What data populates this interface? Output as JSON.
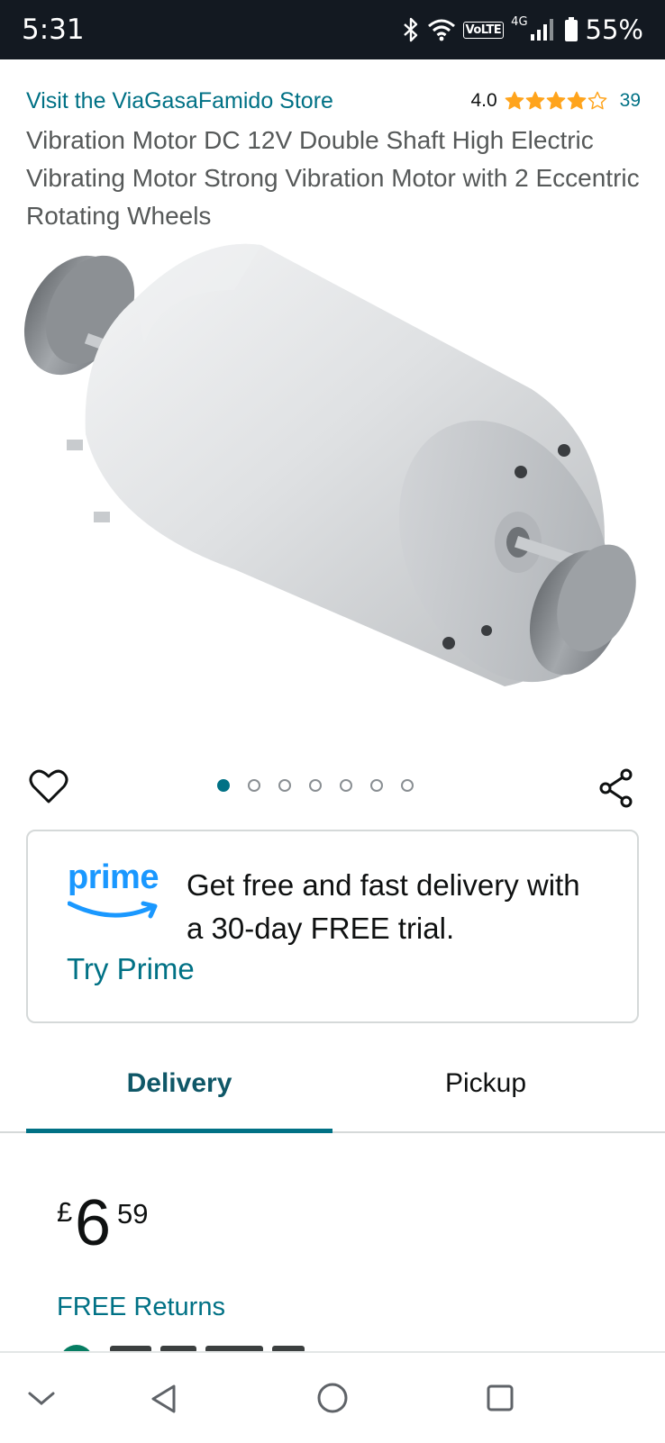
{
  "status_bar": {
    "time": "5:31",
    "volte": "VoLTE",
    "network": "4G",
    "battery": "55%"
  },
  "store": {
    "link_text": "Visit the ViaGasaFamido Store",
    "rating": "4.0",
    "stars_filled": 4,
    "stars_total": 5,
    "rating_count": "39"
  },
  "product": {
    "title": "Vibration Motor DC 12V Double Shaft High Electric Vibrating Motor Strong Vibration Motor with 2 Eccentric Rotating Wheels",
    "image_count": 7,
    "current_image": 1
  },
  "prime": {
    "logo_text": "prime",
    "message": "Get free and fast delivery with a 30-day FREE trial.",
    "cta": "Try Prime"
  },
  "tabs": {
    "delivery": "Delivery",
    "pickup": "Pickup",
    "selected": "Delivery"
  },
  "price": {
    "symbol": "£",
    "whole": "6",
    "fraction": "59"
  },
  "returns": "FREE Returns",
  "colors": {
    "link": "#007185",
    "star": "#ffa41c",
    "prime_blue": "#1a98ff",
    "status_bar": "#131921"
  }
}
